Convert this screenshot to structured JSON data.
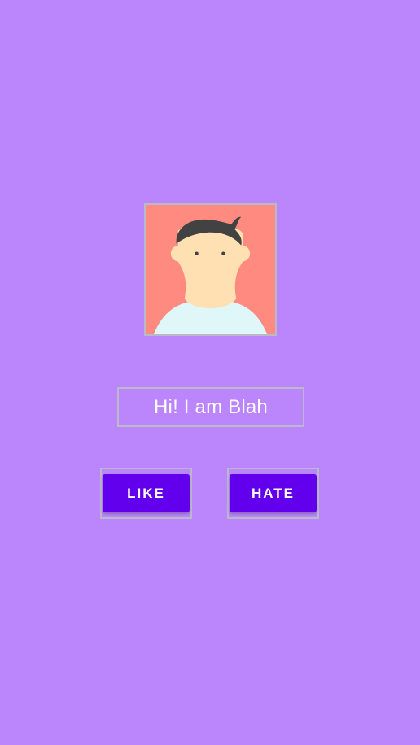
{
  "avatar": {
    "icon": "person-avatar-icon",
    "colors": {
      "background": "#FF8A80",
      "hair": "#424242",
      "skin": "#FFE0B2",
      "shirt": "#E0F7FA"
    }
  },
  "greeting": {
    "text": "Hi! I am Blah"
  },
  "buttons": {
    "like_label": "LIKE",
    "hate_label": "HATE"
  },
  "colors": {
    "page_background": "#BB86FC",
    "button_background": "#6200EE",
    "button_text": "#FFFFFF",
    "outline": "#B9B9C9"
  }
}
